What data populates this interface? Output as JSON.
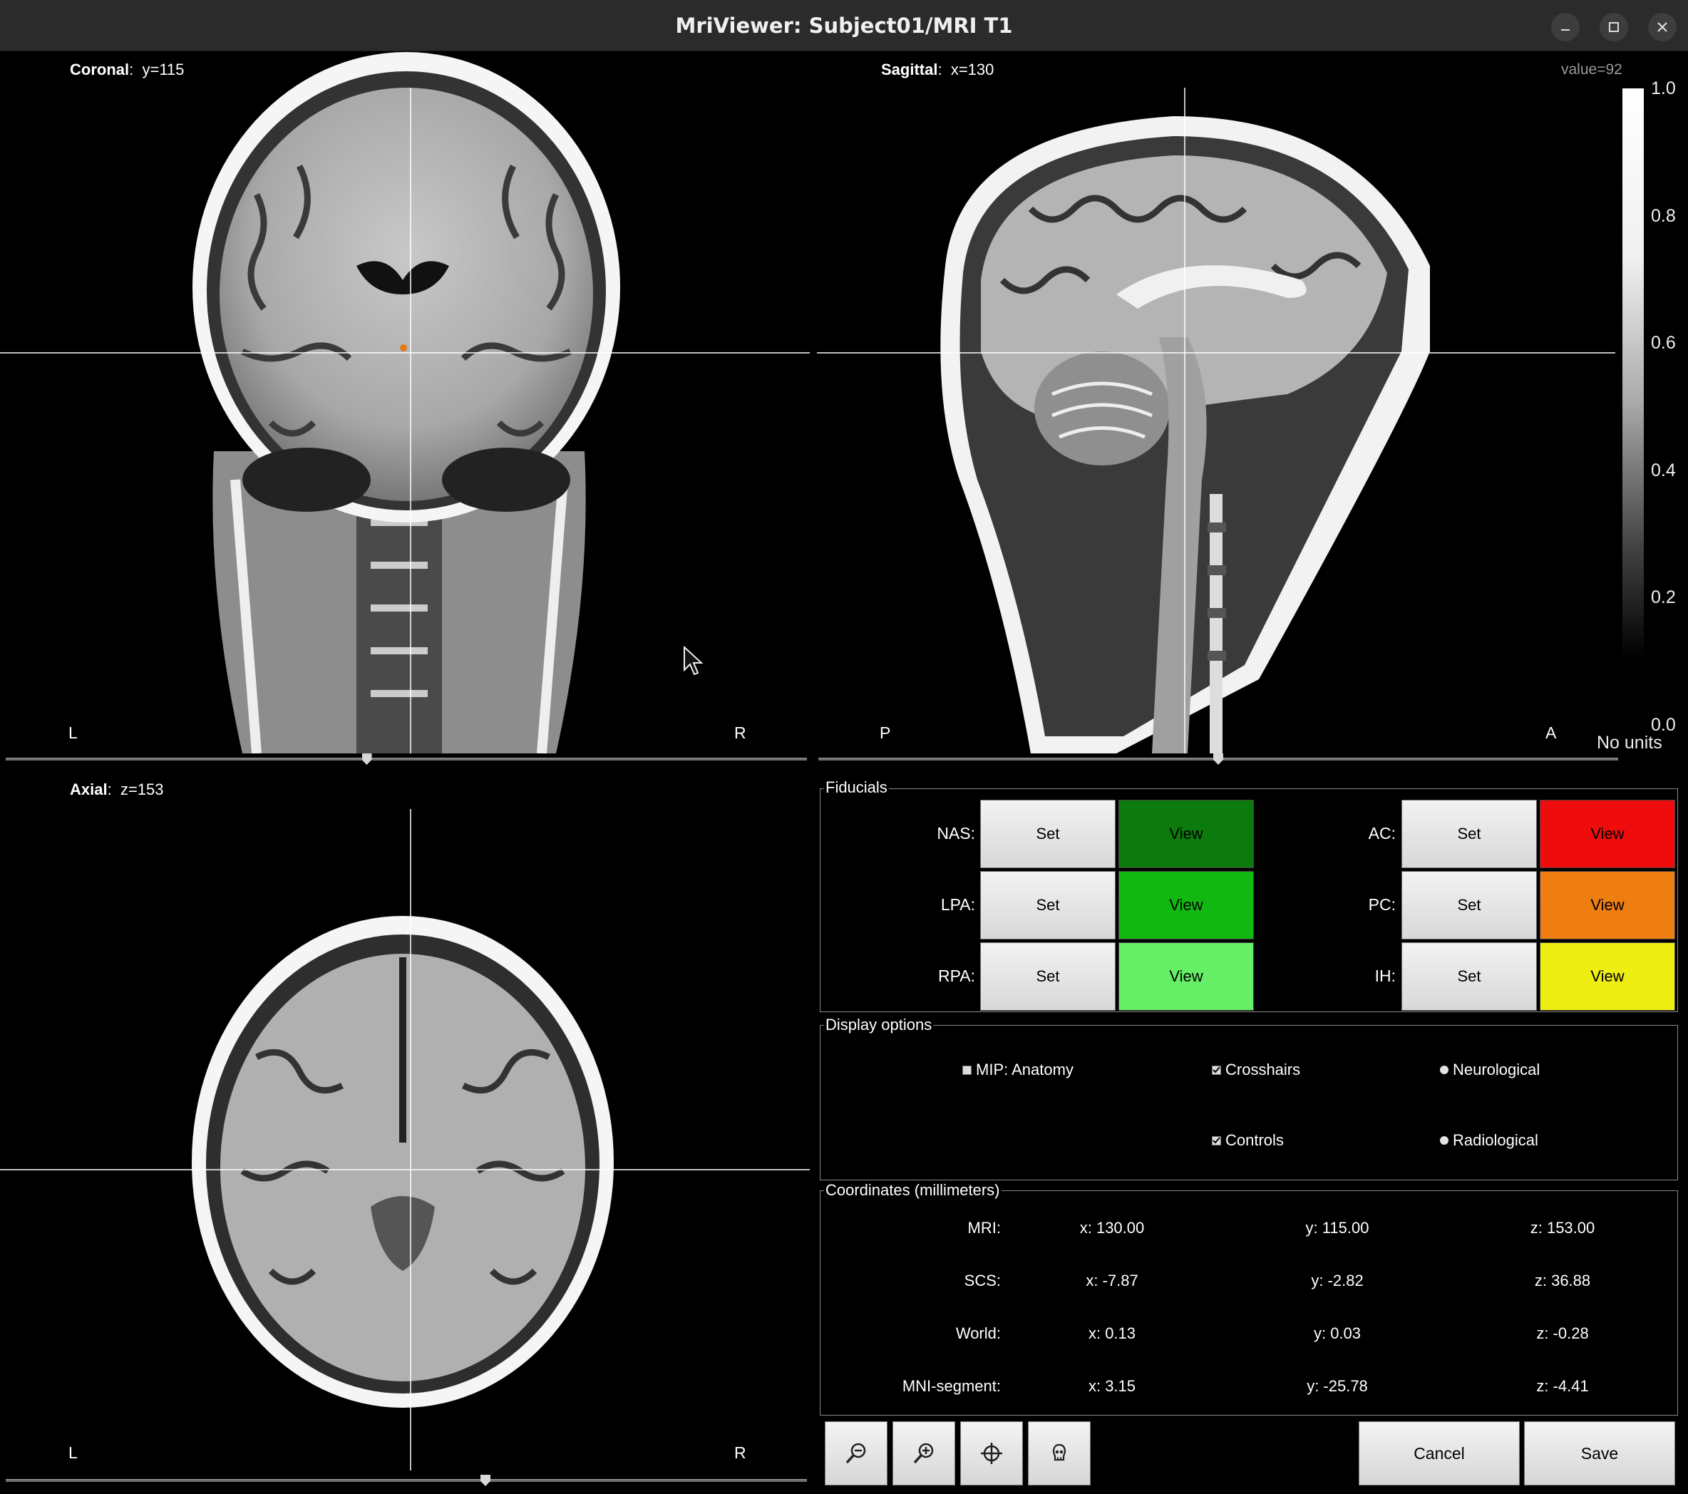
{
  "window": {
    "title": "MriViewer: Subject01/MRI T1"
  },
  "panes": {
    "coronal": {
      "name": "Coronal",
      "coord": "y=115",
      "left": "L",
      "right": "R",
      "slider_fraction": 0.45
    },
    "sagittal": {
      "name": "Sagittal",
      "coord": "x=130",
      "left": "P",
      "right": "A",
      "slider_fraction": 0.5
    },
    "axial": {
      "name": "Axial",
      "coord": "z=153",
      "left": "L",
      "right": "R",
      "slider_fraction": 0.6
    }
  },
  "readout": {
    "value": "value=92"
  },
  "colorbar": {
    "ticks": [
      "1.0",
      "0.8",
      "0.6",
      "0.4",
      "0.2",
      "0.0"
    ],
    "units": "No units"
  },
  "fiducials": {
    "title": "Fiducials",
    "set_label": "Set",
    "view_label": "View",
    "items": [
      {
        "label": "NAS:",
        "color": "#0c7a0c"
      },
      {
        "label": "LPA:",
        "color": "#12b812"
      },
      {
        "label": "RPA:",
        "color": "#66ee66"
      },
      {
        "label": "AC:",
        "color": "#ee0c0c"
      },
      {
        "label": "PC:",
        "color": "#ee7d12"
      },
      {
        "label": "IH:",
        "color": "#eeee12"
      }
    ]
  },
  "display_options": {
    "title": "Display options",
    "mip": "MIP: Anatomy",
    "crosshairs": "Crosshairs",
    "controls": "Controls",
    "neurological": "Neurological",
    "radiological": "Radiological"
  },
  "coordinates": {
    "title": "Coordinates (millimeters)",
    "rows": [
      {
        "label": "MRI:",
        "x": "x: 130.00",
        "y": "y: 115.00",
        "z": "z: 153.00"
      },
      {
        "label": "SCS:",
        "x": "x: -7.87",
        "y": "y: -2.82",
        "z": "z: 36.88"
      },
      {
        "label": "World:",
        "x": "x: 0.13",
        "y": "y: 0.03",
        "z": "z: -0.28"
      },
      {
        "label": "MNI-segment:",
        "x": "x: 3.15",
        "y": "y: -25.78",
        "z": "z: -4.41"
      }
    ]
  },
  "toolbar": {
    "icons": [
      "zoom-out-icon",
      "zoom-in-icon",
      "crosshair-target-icon",
      "skull-icon"
    ],
    "cancel": "Cancel",
    "save": "Save"
  }
}
